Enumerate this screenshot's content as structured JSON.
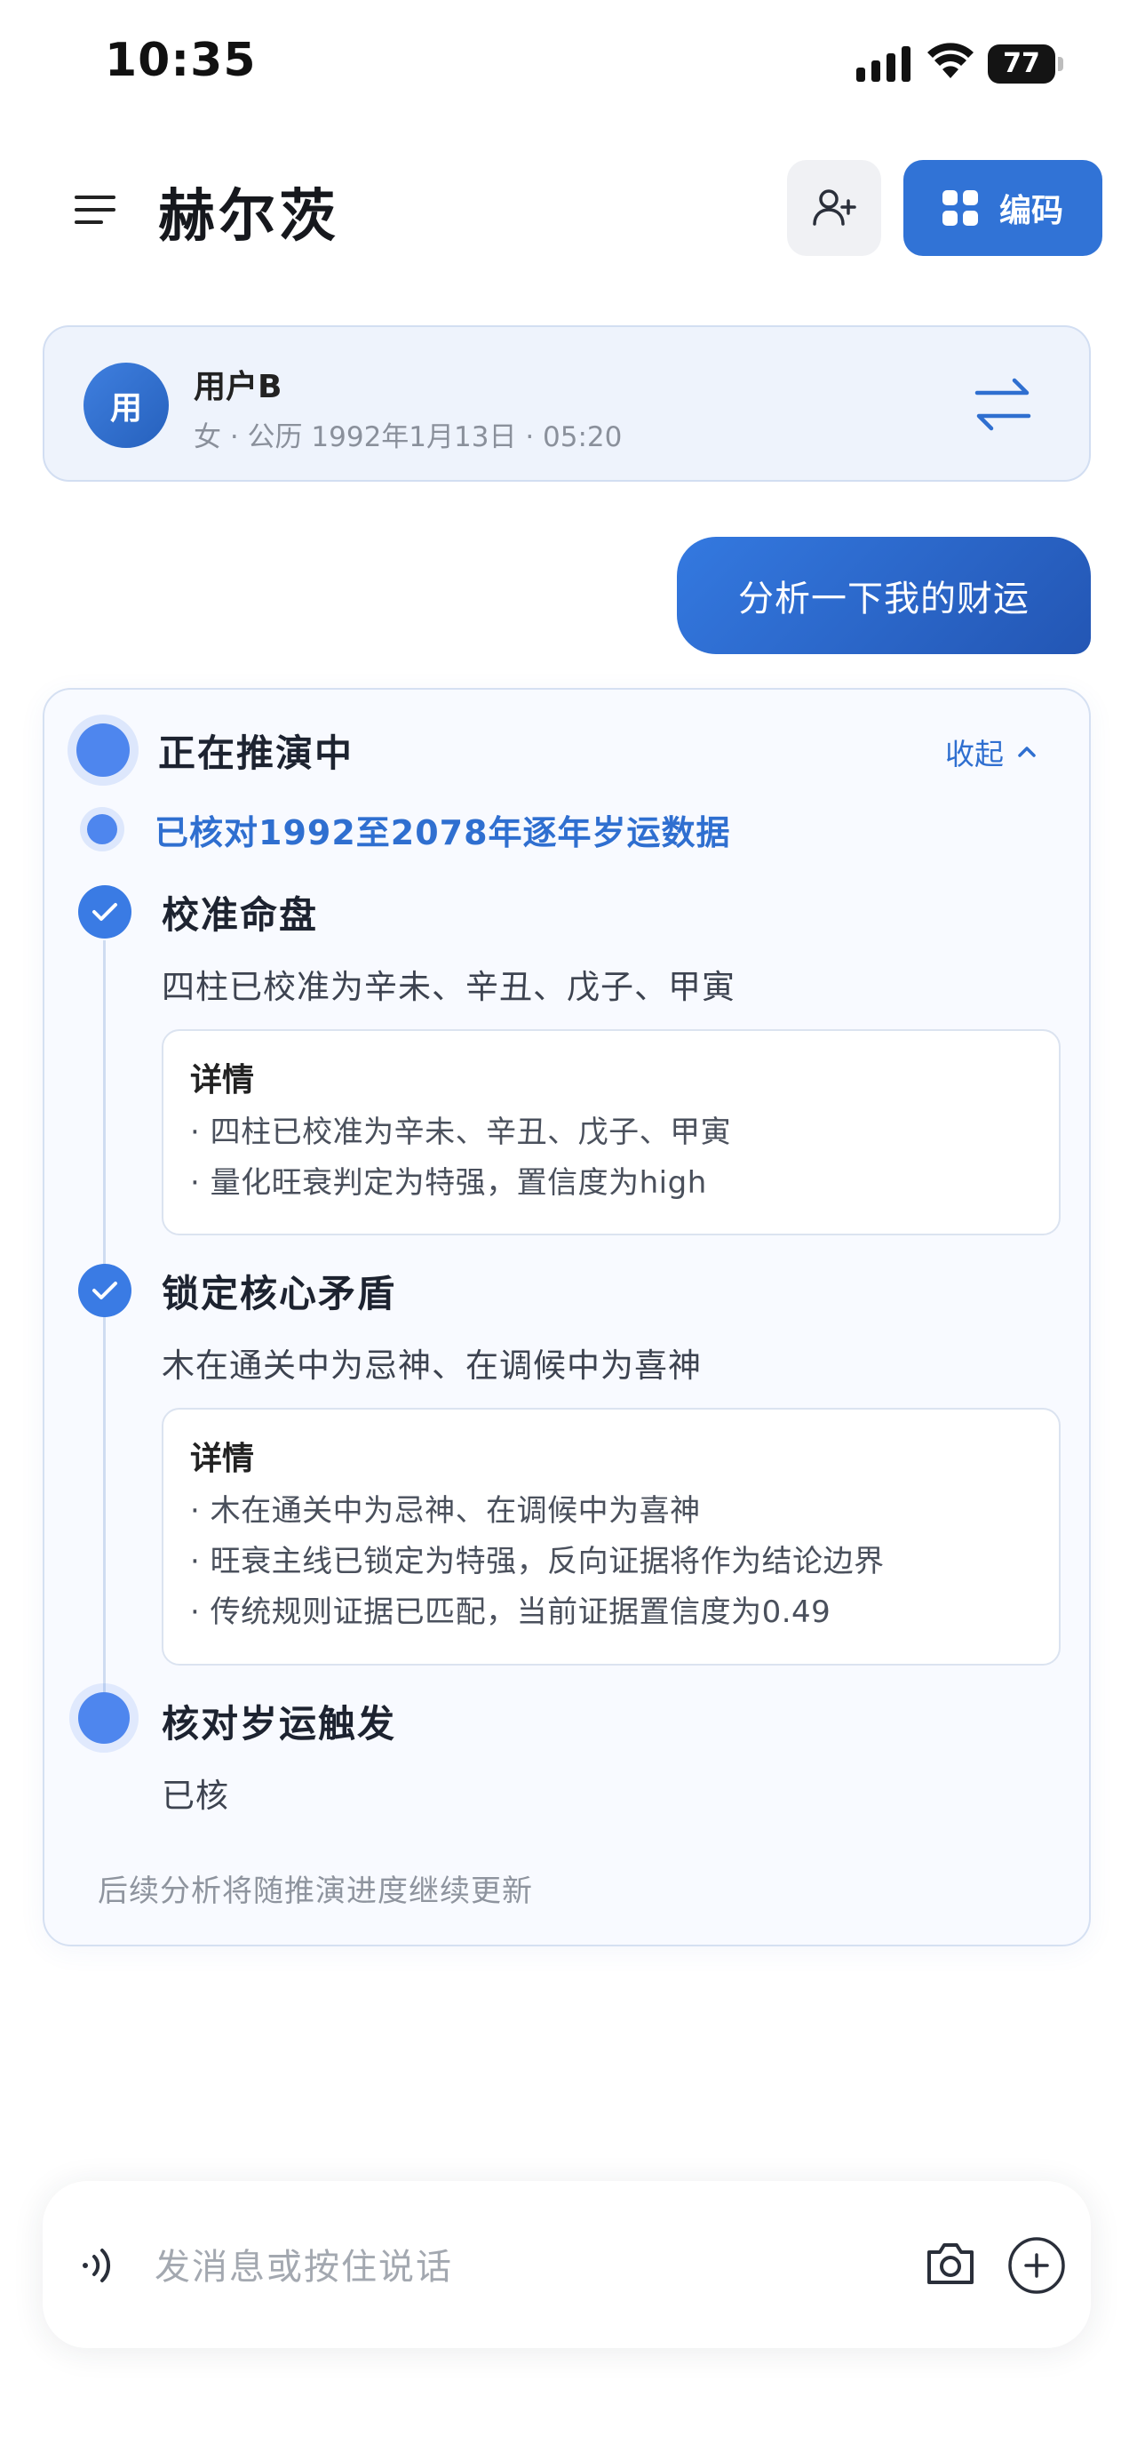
{
  "status_bar": {
    "time": "10:35",
    "battery": "77"
  },
  "header": {
    "title": "赫尔茨",
    "code_button": "编码"
  },
  "profile": {
    "avatar_text": "用",
    "name": "用户B",
    "info": "女 · 公历 1992年1月13日 · 05:20"
  },
  "user_message": "分析一下我的财运",
  "reasoning": {
    "title": "正在推演中",
    "collapse_label": "收起",
    "status": "已核对1992至2078年逐年岁运数据",
    "steps": [
      {
        "title": "校准命盘",
        "summary": "四柱已校准为辛未、辛丑、戊子、甲寅",
        "detail_title": "详情",
        "details": [
          "· 四柱已校准为辛未、辛丑、戊子、甲寅",
          "· 量化旺衰判定为特强，置信度为high"
        ]
      },
      {
        "title": "锁定核心矛盾",
        "summary": "木在通关中为忌神、在调候中为喜神",
        "detail_title": "详情",
        "details": [
          "· 木在通关中为忌神、在调候中为喜神",
          "· 旺衰主线已锁定为特强，反向证据将作为结论边界",
          "· 传统规则证据已匹配，当前证据置信度为0.49"
        ]
      },
      {
        "title": "核对岁运触发",
        "summary": "已核"
      }
    ],
    "footer": "后续分析将随推演进度继续更新"
  },
  "input": {
    "placeholder": "发消息或按住说话"
  },
  "colors": {
    "accent": "#3173d6",
    "card_bg": "#f8faff",
    "profile_bg": "#eef3fc"
  }
}
